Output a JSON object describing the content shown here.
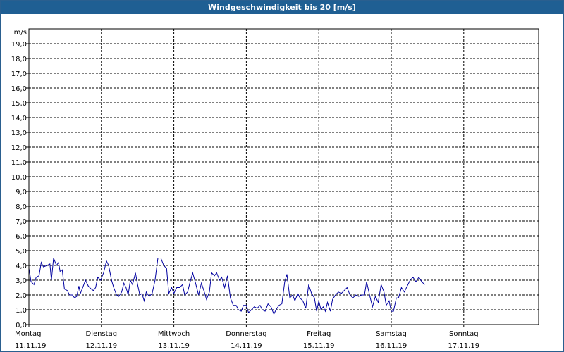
{
  "title": "Windgeschwindigkeit bis 20 [m/s]",
  "colors": {
    "titlebar": "#1f5f93",
    "line": "#0000a0",
    "grid": "#000000"
  },
  "chart_data": {
    "type": "line",
    "title": "Windgeschwindigkeit bis 20 [m/s]",
    "ylabel": "m/s",
    "ylim": [
      0,
      20
    ],
    "yticks": [
      "0,0",
      "1,0",
      "2,0",
      "3,0",
      "4,0",
      "5,0",
      "6,0",
      "7,0",
      "8,0",
      "9,0",
      "10,0",
      "11,0",
      "12,0",
      "13,0",
      "14,0",
      "15,0",
      "16,0",
      "17,0",
      "18,0",
      "19,0"
    ],
    "xlim": [
      0,
      7
    ],
    "grid": true,
    "x_ticks": [
      {
        "day": "Montag",
        "date": "11.11.19",
        "x": 0
      },
      {
        "day": "Dienstag",
        "date": "12.11.19",
        "x": 1
      },
      {
        "day": "Mittwoch",
        "date": "13.11.19",
        "x": 2
      },
      {
        "day": "Donnerstag",
        "date": "14.11.19",
        "x": 3
      },
      {
        "day": "Freitag",
        "date": "15.11.19",
        "x": 4
      },
      {
        "day": "Samstag",
        "date": "16.11.19",
        "x": 5
      },
      {
        "day": "Sonntag",
        "date": "17.11.19",
        "x": 6
      }
    ],
    "series": [
      {
        "points": [
          [
            0.0,
            3.8
          ],
          [
            0.03,
            2.9
          ],
          [
            0.07,
            2.7
          ],
          [
            0.1,
            3.2
          ],
          [
            0.14,
            3.3
          ],
          [
            0.17,
            4.2
          ],
          [
            0.2,
            3.9
          ],
          [
            0.25,
            4.0
          ],
          [
            0.29,
            4.1
          ],
          [
            0.31,
            3.0
          ],
          [
            0.34,
            4.5
          ],
          [
            0.38,
            4.0
          ],
          [
            0.41,
            4.2
          ],
          [
            0.43,
            3.6
          ],
          [
            0.46,
            3.7
          ],
          [
            0.49,
            2.4
          ],
          [
            0.53,
            2.3
          ],
          [
            0.56,
            2.0
          ],
          [
            0.6,
            2.0
          ],
          [
            0.63,
            1.8
          ],
          [
            0.66,
            1.9
          ],
          [
            0.69,
            2.6
          ],
          [
            0.71,
            2.1
          ],
          [
            0.75,
            2.6
          ],
          [
            0.78,
            3.0
          ],
          [
            0.82,
            2.6
          ],
          [
            0.86,
            2.4
          ],
          [
            0.89,
            2.3
          ],
          [
            0.92,
            2.5
          ],
          [
            0.95,
            3.2
          ],
          [
            0.99,
            3.0
          ],
          [
            1.03,
            3.5
          ],
          [
            1.07,
            4.3
          ],
          [
            1.1,
            4.0
          ],
          [
            1.14,
            3.0
          ],
          [
            1.17,
            2.5
          ],
          [
            1.21,
            2.0
          ],
          [
            1.24,
            1.9
          ],
          [
            1.28,
            2.2
          ],
          [
            1.31,
            2.8
          ],
          [
            1.34,
            2.5
          ],
          [
            1.37,
            2.0
          ],
          [
            1.4,
            3.0
          ],
          [
            1.43,
            2.7
          ],
          [
            1.47,
            3.5
          ],
          [
            1.5,
            2.7
          ],
          [
            1.53,
            2.0
          ],
          [
            1.56,
            2.1
          ],
          [
            1.59,
            1.6
          ],
          [
            1.62,
            2.2
          ],
          [
            1.66,
            1.9
          ],
          [
            1.7,
            2.1
          ],
          [
            1.74,
            3.0
          ],
          [
            1.78,
            4.5
          ],
          [
            1.82,
            4.5
          ],
          [
            1.86,
            4.0
          ],
          [
            1.9,
            3.8
          ],
          [
            1.93,
            2.1
          ],
          [
            1.97,
            2.5
          ],
          [
            2.0,
            2.1
          ],
          [
            2.04,
            2.5
          ],
          [
            2.08,
            2.5
          ],
          [
            2.12,
            2.7
          ],
          [
            2.15,
            2.0
          ],
          [
            2.19,
            2.2
          ],
          [
            2.22,
            2.8
          ],
          [
            2.26,
            3.5
          ],
          [
            2.3,
            2.8
          ],
          [
            2.34,
            2.0
          ],
          [
            2.38,
            2.8
          ],
          [
            2.42,
            2.2
          ],
          [
            2.45,
            1.7
          ],
          [
            2.49,
            2.2
          ],
          [
            2.52,
            3.5
          ],
          [
            2.56,
            3.3
          ],
          [
            2.59,
            3.5
          ],
          [
            2.63,
            3.0
          ],
          [
            2.66,
            3.2
          ],
          [
            2.7,
            2.5
          ],
          [
            2.74,
            3.3
          ],
          [
            2.78,
            1.8
          ],
          [
            2.82,
            1.3
          ],
          [
            2.86,
            1.3
          ],
          [
            2.89,
            1.0
          ],
          [
            2.93,
            0.9
          ],
          [
            2.96,
            1.3
          ],
          [
            3.0,
            1.3
          ],
          [
            3.03,
            0.8
          ],
          [
            3.07,
            1.0
          ],
          [
            3.11,
            1.2
          ],
          [
            3.15,
            1.1
          ],
          [
            3.19,
            1.3
          ],
          [
            3.22,
            1.0
          ],
          [
            3.26,
            0.9
          ],
          [
            3.3,
            1.4
          ],
          [
            3.34,
            1.2
          ],
          [
            3.38,
            0.7
          ],
          [
            3.41,
            1.0
          ],
          [
            3.45,
            1.3
          ],
          [
            3.49,
            1.4
          ],
          [
            3.53,
            2.9
          ],
          [
            3.56,
            3.4
          ],
          [
            3.6,
            1.8
          ],
          [
            3.64,
            2.0
          ],
          [
            3.67,
            1.6
          ],
          [
            3.71,
            2.1
          ],
          [
            3.74,
            1.8
          ],
          [
            3.78,
            1.6
          ],
          [
            3.82,
            1.1
          ],
          [
            3.86,
            2.7
          ],
          [
            3.9,
            2.1
          ],
          [
            3.94,
            1.8
          ],
          [
            3.97,
            0.9
          ],
          [
            4.0,
            1.6
          ],
          [
            4.03,
            1.0
          ],
          [
            4.06,
            1.2
          ],
          [
            4.09,
            0.9
          ],
          [
            4.12,
            1.5
          ],
          [
            4.16,
            0.9
          ],
          [
            4.19,
            1.7
          ],
          [
            4.23,
            2.0
          ],
          [
            4.27,
            2.2
          ],
          [
            4.31,
            2.1
          ],
          [
            4.35,
            2.3
          ],
          [
            4.39,
            2.5
          ],
          [
            4.43,
            2.0
          ],
          [
            4.47,
            1.8
          ],
          [
            4.51,
            2.0
          ],
          [
            4.55,
            1.9
          ],
          [
            4.59,
            2.0
          ],
          [
            4.63,
            2.0
          ],
          [
            4.66,
            2.9
          ],
          [
            4.7,
            2.0
          ],
          [
            4.74,
            1.2
          ],
          [
            4.78,
            1.9
          ],
          [
            4.82,
            1.5
          ],
          [
            4.86,
            2.7
          ],
          [
            4.9,
            2.2
          ],
          [
            4.93,
            1.3
          ],
          [
            4.97,
            1.6
          ],
          [
            5.0,
            0.9
          ],
          [
            5.03,
            0.9
          ],
          [
            5.07,
            1.8
          ],
          [
            5.1,
            1.8
          ],
          [
            5.14,
            2.5
          ],
          [
            5.18,
            2.2
          ],
          [
            5.22,
            2.6
          ],
          [
            5.26,
            3.0
          ],
          [
            5.3,
            3.2
          ],
          [
            5.34,
            2.9
          ],
          [
            5.38,
            3.2
          ],
          [
            5.42,
            2.9
          ],
          [
            5.46,
            2.7
          ]
        ]
      }
    ]
  }
}
